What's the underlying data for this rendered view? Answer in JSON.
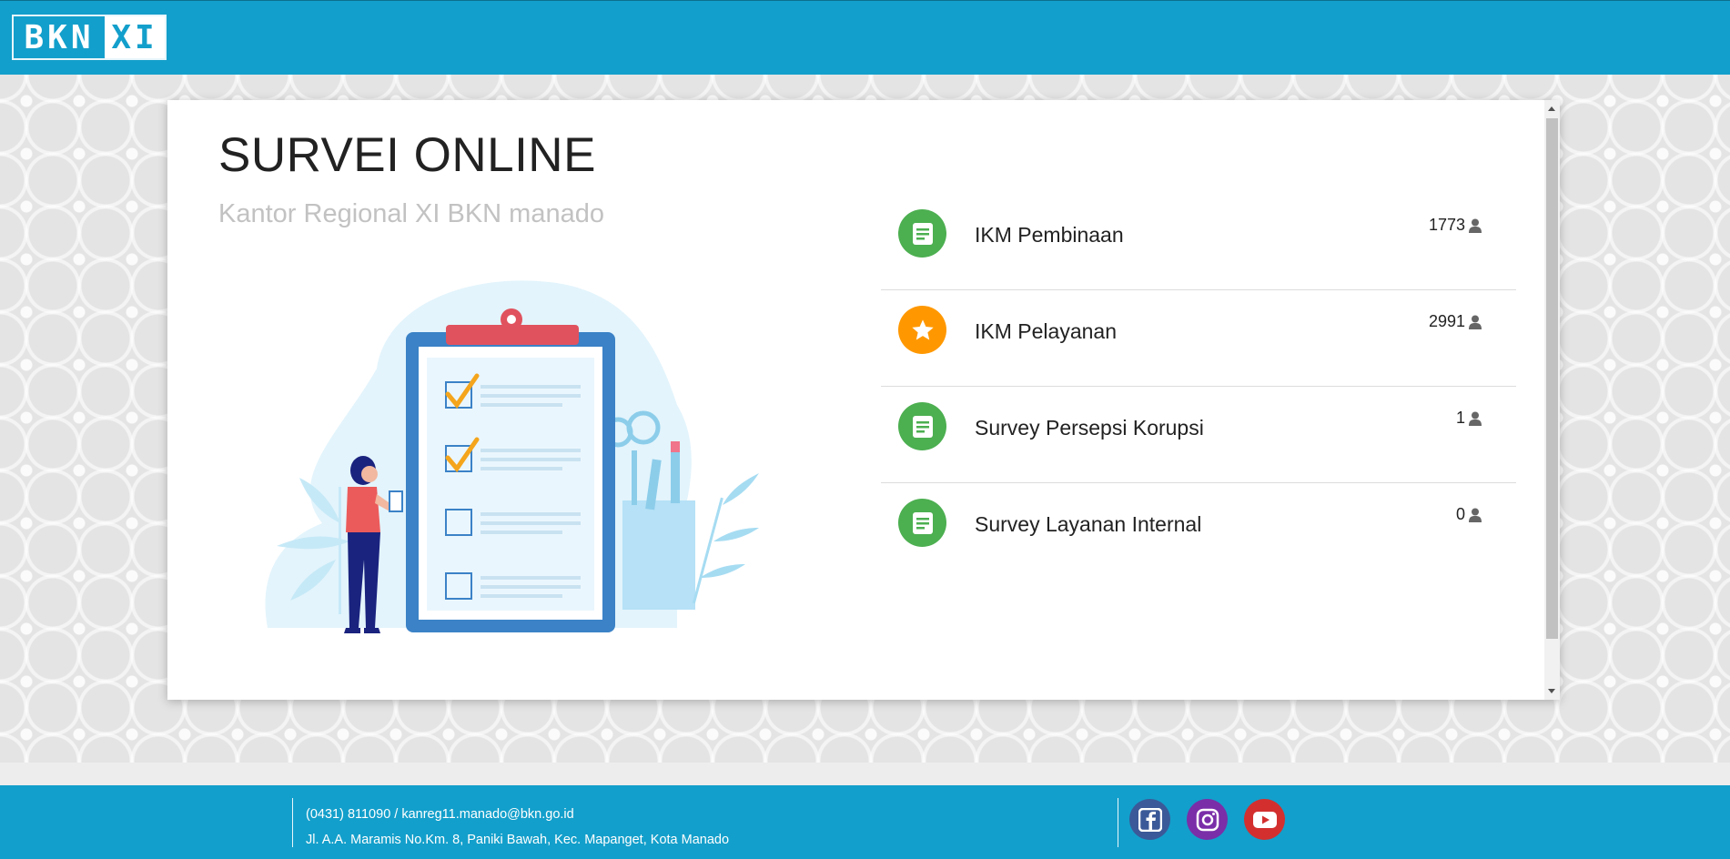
{
  "header": {
    "logo_part1": "BKN",
    "logo_part2": "XI"
  },
  "main": {
    "title": "SURVEI ONLINE",
    "subtitle": "Kantor Regional XI BKN manado"
  },
  "surveys": [
    {
      "label": "IKM Pembinaan",
      "count": "1773",
      "icon": "document-icon",
      "color": "#4caf50"
    },
    {
      "label": "IKM Pelayanan",
      "count": "2991",
      "icon": "star-icon",
      "color": "#ff9800"
    },
    {
      "label": "Survey Persepsi Korupsi",
      "count": "1",
      "icon": "document-icon",
      "color": "#4caf50"
    },
    {
      "label": "Survey Layanan Internal",
      "count": "0",
      "icon": "document-icon",
      "color": "#4caf50"
    }
  ],
  "footer": {
    "contact": "(0431) 811090 / kanreg11.manado@bkn.go.id",
    "address": "Jl. A.A. Maramis No.Km. 8, Paniki Bawah, Kec. Mapanget, Kota Manado",
    "social": [
      {
        "name": "facebook-icon",
        "color": "#3b5998"
      },
      {
        "name": "instagram-icon",
        "color": "#7a2ea8"
      },
      {
        "name": "youtube-icon",
        "color": "#d32f2f"
      }
    ]
  }
}
